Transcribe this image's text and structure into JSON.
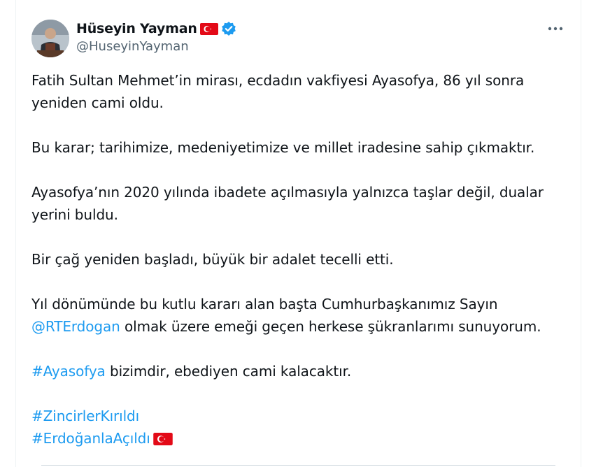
{
  "author": {
    "display_name": "Hüseyin Yayman",
    "handle": "@HuseyinYayman",
    "flag_icon": "turkey-flag-icon",
    "verified_icon": "verified-badge-icon"
  },
  "menu": {
    "icon": "more-horizontal-icon"
  },
  "tweet": {
    "p1": "Fatih Sultan Mehmet’in mirası, ecdadın vakfiyesi Ayasofya, 86 yıl sonra yeniden cami oldu.",
    "p2": "Bu karar; tarihimize, medeniyetimize ve millet iradesine sahip çıkmaktır.",
    "p3": "Ayasofya’nın 2020 yılında ibadete açılmasıyla yalnızca taşlar değil, dualar yerini buldu.",
    "p4": "Bir çağ yeniden başladı, büyük bir adalet tecelli etti.",
    "p5_text": "Yıl dönümünde bu kutlu kararı alan başta Cumhurbaşkanımız Sayın",
    "p5_mention": "@RTErdogan",
    "p5_tail": " olmak üzere emeği geçen herkese şükranlarımı sunuyorum.",
    "p6_hashtag": "#Ayasofya",
    "p6_tail": " bizimdir, ebediyen cami kalacaktır.",
    "hashtag1": "#ZincirlerKırıldı",
    "hashtag2": "#ErdoğanlaAçıldı"
  },
  "colors": {
    "link": "#1d9bf0",
    "text": "#0f1419",
    "secondary": "#536471",
    "flag_red": "#e30a17",
    "verified_blue": "#1d9bf0"
  }
}
